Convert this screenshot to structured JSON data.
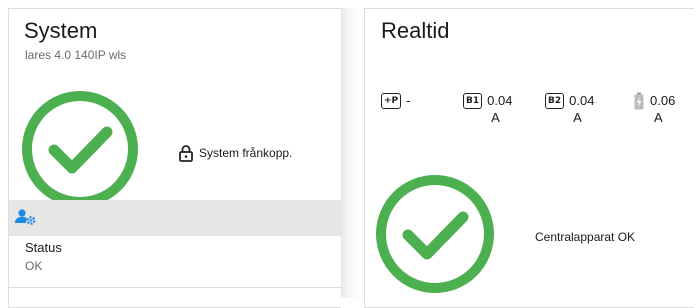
{
  "colors": {
    "ok_green": "#4caf50",
    "accent_blue": "#1e88e5"
  },
  "system": {
    "title": "System",
    "subtitle": "lares 4.0 140IP wls",
    "status_icon": "check-circle-icon",
    "lock_icon": "lock-icon",
    "lock_label": "System frånkopp.",
    "user_icon": "user-gear-icon",
    "status_label": "Status",
    "status_value": "OK"
  },
  "realtime": {
    "title": "Realtid",
    "items": [
      {
        "icon": "+P",
        "value": "-",
        "unit": ""
      },
      {
        "icon": "B1",
        "value": "0.04",
        "unit": "A"
      },
      {
        "icon": "B2",
        "value": "0.04",
        "unit": "A"
      },
      {
        "icon": "battery-icon",
        "value": "0.06",
        "unit": "A"
      }
    ],
    "status_icon": "check-circle-icon",
    "central_label": "Centralapparat OK"
  }
}
